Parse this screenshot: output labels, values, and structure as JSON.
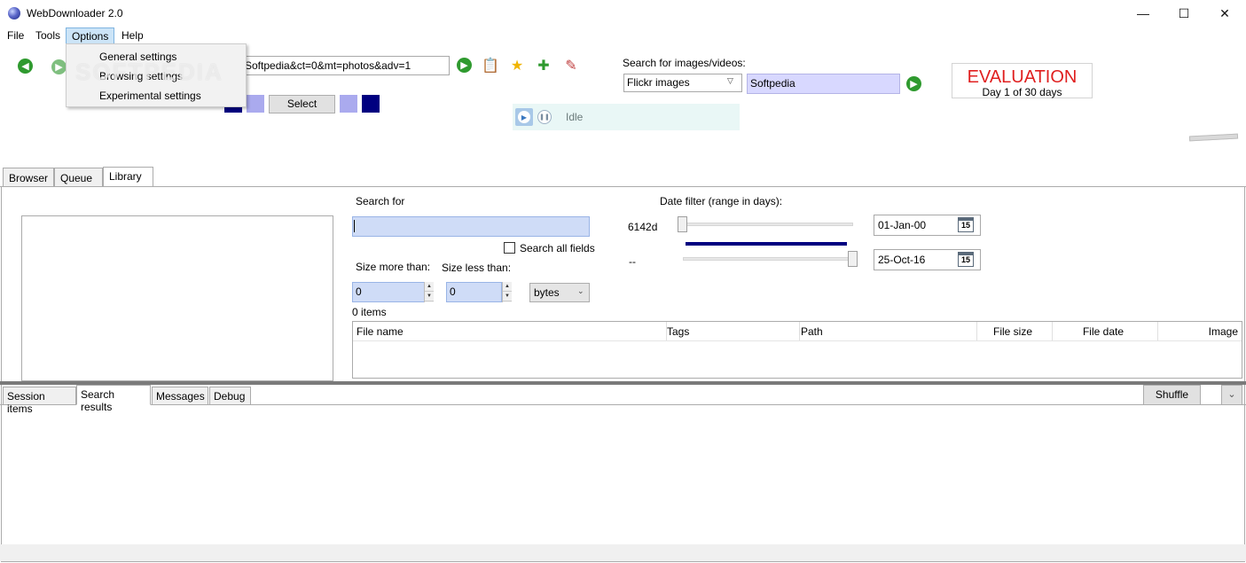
{
  "window": {
    "title": "WebDownloader 2.0",
    "minimize": "—",
    "maximize": "☐",
    "close": "✕"
  },
  "menu": {
    "file": "File",
    "tools": "Tools",
    "options": "Options",
    "help": "Help"
  },
  "options_menu": {
    "items": [
      "General settings",
      "Browsing settings",
      "Experimental settings"
    ]
  },
  "watermark": "SOFTPEDIA",
  "toolbar": {
    "url_value": "Softpedia&ct=0&mt=photos&adv=1",
    "select_label": "Select",
    "colors": {
      "swatch_dark": "#000080",
      "swatch_light": "#aaaaee"
    }
  },
  "status": {
    "text": "Idle"
  },
  "image_search": {
    "label": "Search for images/videos:",
    "source": "Flickr images",
    "query": "Softpedia"
  },
  "evaluation": {
    "title": "EVALUATION",
    "subtitle": "Day 1 of 30 days"
  },
  "tabs": [
    "Browser",
    "Queue",
    "Library"
  ],
  "active_tab": "Library",
  "library": {
    "search_for_label": "Search for",
    "search_value": "",
    "search_all_fields_label": "Search all fields",
    "search_all_fields_checked": false,
    "size_more_label": "Size more than:",
    "size_less_label": "Size less than:",
    "size_more_value": "0",
    "size_less_value": "0",
    "size_unit": "bytes",
    "items_count": "0 items",
    "date_filter_label": "Date filter (range in days):",
    "range_from_label": "6142d",
    "range_to_label": "--",
    "date_from": "01-Jan-00",
    "date_to": "25-Oct-16",
    "calendar_day": "15",
    "columns": [
      "File name",
      "Tags",
      "Path",
      "File size",
      "File date",
      "Image"
    ]
  },
  "bottom_tabs": [
    "Session items",
    "Search results",
    "Messages",
    "Debug"
  ],
  "active_bottom_tab": "Search results",
  "shuffle_label": "Shuffle",
  "collapse_icon": "⌄"
}
